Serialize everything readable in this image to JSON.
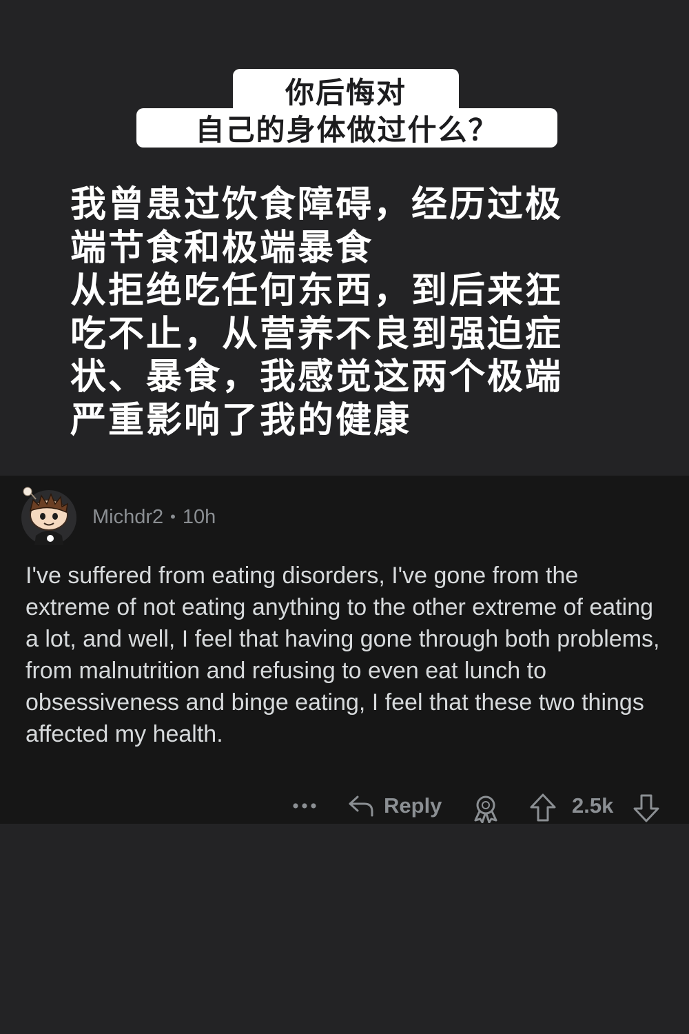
{
  "post": {
    "title_line_1": "你后悔对",
    "title_line_2": "自己的身体做过什么？",
    "text_lines": [
      "我曾患过饮食障碍，经历过极",
      "端节食和极端暴食",
      "从拒绝吃任何东西，到后来狂",
      "吃不止，从营养不良到强迫症",
      "状、暴食，我感觉这两个极端",
      "严重影响了我的健康"
    ]
  },
  "comment": {
    "username": "Michdr2",
    "separator": "•",
    "time": "10h",
    "avatar": "snoo-avatar",
    "body": "I've suffered from eating disorders, I've gone from the extreme of not eating anything to the other extreme of eating a lot, and well, I feel that having gone through both problems, from malnutrition and refusing to even eat lunch to obsessiveness and binge eating, I feel that these two things affected my health."
  },
  "actions": {
    "more": "•••",
    "reply_label": "Reply",
    "vote_count": "2.5k",
    "icons": [
      "more-icon",
      "reply-icon",
      "award-icon",
      "upvote-icon",
      "downvote-icon"
    ]
  },
  "colors": {
    "page_background": "#232325",
    "comment_background": "#161616",
    "title_box": "#ffffff",
    "meta_text": "#8b8f93",
    "comment_text": "#d7dadc"
  }
}
